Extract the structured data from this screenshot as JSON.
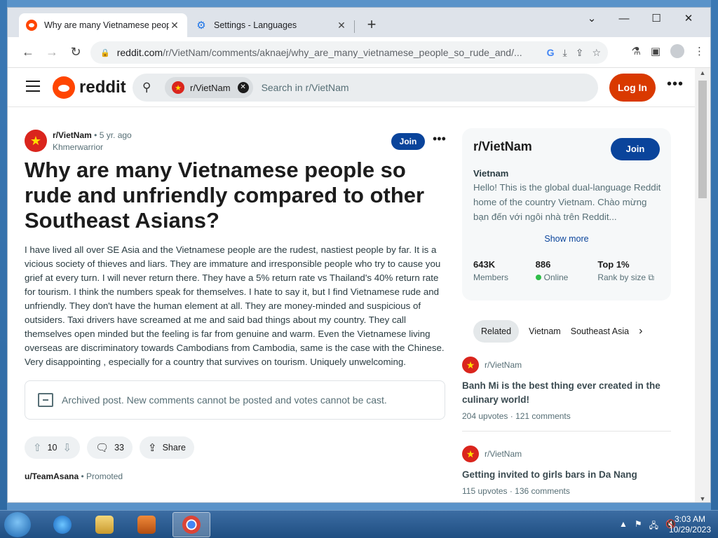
{
  "browser": {
    "tabs": [
      {
        "title": "Why are many Vietnamese peop",
        "active": true
      },
      {
        "title": "Settings - Languages",
        "active": false
      }
    ],
    "url_host": "reddit.com",
    "url_path": "/r/VietNam/comments/aknaej/why_are_many_vietnamese_people_so_rude_and/..."
  },
  "header": {
    "wordmark": "reddit",
    "search_chip": "r/VietNam",
    "search_placeholder": "Search in r/VietNam",
    "login_label": "Log In"
  },
  "post": {
    "subreddit": "r/VietNam",
    "time": "• 5 yr. ago",
    "author": "Khmerwarrior",
    "join_label": "Join",
    "title": "Why are many Vietnamese people so rude and unfriendly compared to other Southeast Asians?",
    "body": "I have lived all over SE Asia and the Vietnamese people are the rudest, nastiest people by far. It is a vicious society of thieves and liars. They are immature and irresponsible people who try to cause you grief at every turn. I will never return there. They have a 5% return rate vs Thailand's 40% return rate for tourism. I think the numbers speak for themselves. I hate to say it, but I find Vietnamese rude and unfriendly. They don't have the human element at all. They are money-minded and suspicious of outsiders. Taxi drivers have screamed at me and said bad things about my country. They call themselves open minded but the feeling is far from genuine and warm. Even the Vietnamese living overseas are discriminatory towards Cambodians from Cambodia, same is the case with the Chinese. Very disappointing , especially for a country that survives on tourism. Uniquely unwelcoming.",
    "archived_notice": "Archived post. New comments cannot be posted and votes cannot be cast.",
    "votes": "10",
    "comments": "33",
    "share_label": "Share",
    "promoted_user": "u/TeamAsana",
    "promoted_label": "• Promoted"
  },
  "sidebar": {
    "name": "r/VietNam",
    "join_label": "Join",
    "title": "Vietnam",
    "description": "Hello! This is the global dual-language Reddit home of the country Vietnam. Chào mừng bạn đến với ngôi nhà trên Reddit...",
    "show_more": "Show more",
    "stats": [
      {
        "value": "643K",
        "label": "Members"
      },
      {
        "value": "886",
        "label": "Online"
      },
      {
        "value": "Top 1%",
        "label": "Rank by size"
      }
    ],
    "related_tabs": [
      "Related",
      "Vietnam",
      "Southeast Asia"
    ],
    "related_posts": [
      {
        "sub": "r/VietNam",
        "title": "Banh Mi is the best thing ever created in the culinary world!",
        "upvotes": "204 upvotes",
        "comments": "121 comments"
      },
      {
        "sub": "r/VietNam",
        "title": "Getting invited to girls bars in Da Nang",
        "upvotes": "115 upvotes",
        "comments": "136 comments"
      }
    ]
  },
  "taskbar": {
    "time": "3:03 AM",
    "date": "10/29/2023"
  }
}
